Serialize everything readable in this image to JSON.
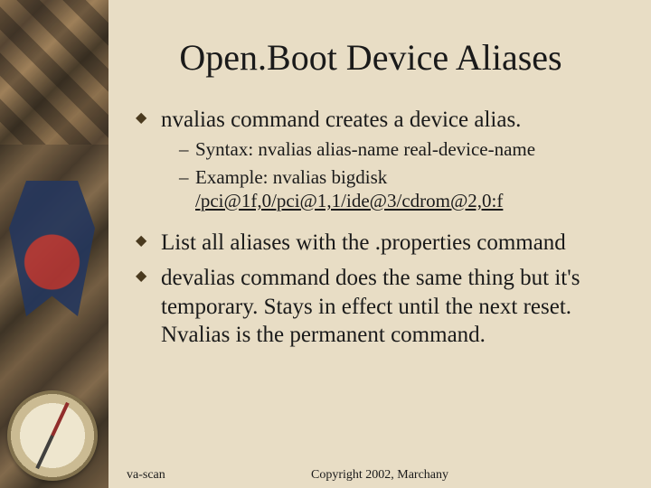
{
  "title": "Open.Boot Device Aliases",
  "bullets": {
    "b1": "nvalias command creates a device alias.",
    "b1_sub1": "Syntax: nvalias alias-name real-device-name",
    "b1_sub2a": "Example: nvalias bigdisk ",
    "b1_sub2_path": "/pci@1f,0/pci@1,1/ide@3/cdrom@2,0:f",
    "b2": "List all aliases with the .properties command",
    "b3": " devalias command does the same thing but it's temporary. Stays in effect until the next reset. Nvalias is the permanent command."
  },
  "footer": {
    "left": "va-scan",
    "center": "Copyright 2002, Marchany"
  }
}
